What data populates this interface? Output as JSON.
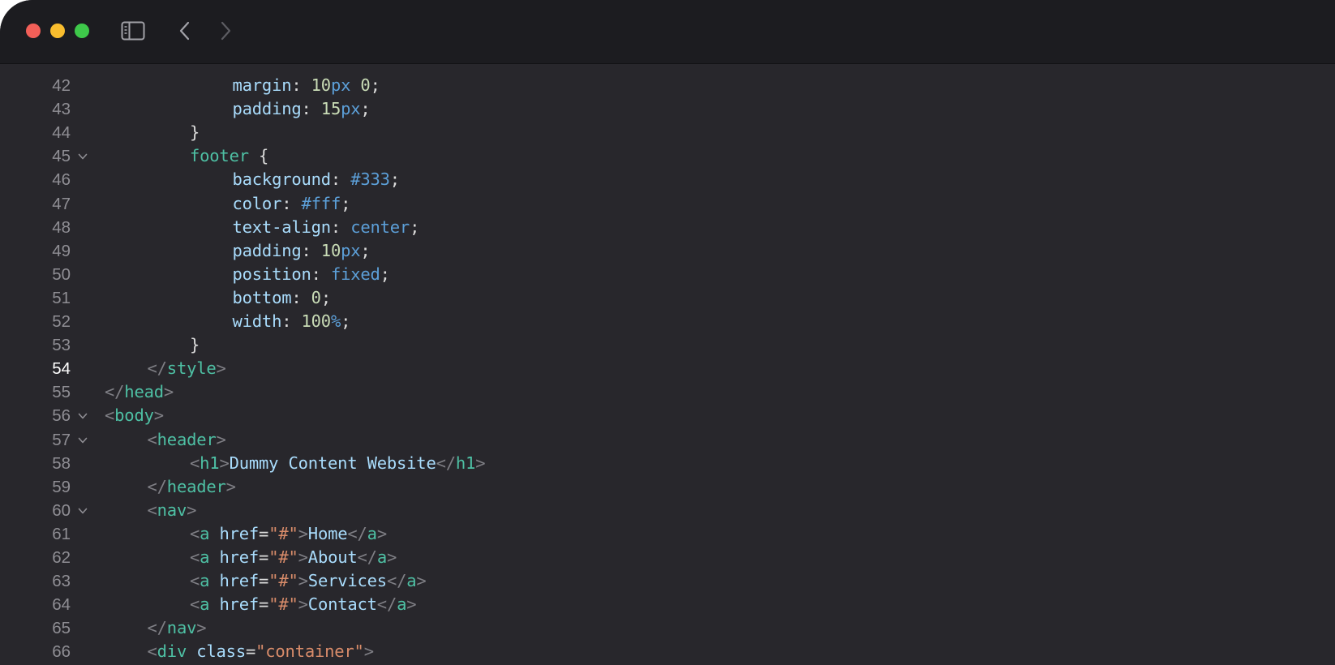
{
  "window": {
    "controls": [
      "close",
      "minimize",
      "zoom"
    ],
    "toolbar_icons": [
      "sidebar-icon",
      "chevron-left-icon",
      "chevron-right-icon"
    ]
  },
  "editor": {
    "current_line": 54,
    "lines": [
      {
        "n": "42",
        "fold": false,
        "indent": 3,
        "tokens": [
          [
            "prop",
            "margin"
          ],
          [
            "pn",
            ": "
          ],
          [
            "num",
            "10"
          ],
          [
            "unit",
            "px"
          ],
          [
            "pn",
            " "
          ],
          [
            "num",
            "0"
          ],
          [
            "pn",
            ";"
          ]
        ]
      },
      {
        "n": "43",
        "fold": false,
        "indent": 3,
        "tokens": [
          [
            "prop",
            "padding"
          ],
          [
            "pn",
            ": "
          ],
          [
            "num",
            "15"
          ],
          [
            "unit",
            "px"
          ],
          [
            "pn",
            ";"
          ]
        ]
      },
      {
        "n": "44",
        "fold": false,
        "indent": 2,
        "tokens": [
          [
            "pn",
            "}"
          ]
        ]
      },
      {
        "n": "45",
        "fold": true,
        "indent": 2,
        "tokens": [
          [
            "sel",
            "footer"
          ],
          [
            "pn",
            " {"
          ]
        ]
      },
      {
        "n": "46",
        "fold": false,
        "indent": 3,
        "tokens": [
          [
            "prop",
            "background"
          ],
          [
            "pn",
            ": "
          ],
          [
            "kw",
            "#333"
          ],
          [
            "pn",
            ";"
          ]
        ]
      },
      {
        "n": "47",
        "fold": false,
        "indent": 3,
        "tokens": [
          [
            "prop",
            "color"
          ],
          [
            "pn",
            ": "
          ],
          [
            "kw",
            "#fff"
          ],
          [
            "pn",
            ";"
          ]
        ]
      },
      {
        "n": "48",
        "fold": false,
        "indent": 3,
        "tokens": [
          [
            "prop",
            "text-align"
          ],
          [
            "pn",
            ": "
          ],
          [
            "kw",
            "center"
          ],
          [
            "pn",
            ";"
          ]
        ]
      },
      {
        "n": "49",
        "fold": false,
        "indent": 3,
        "tokens": [
          [
            "prop",
            "padding"
          ],
          [
            "pn",
            ": "
          ],
          [
            "num",
            "10"
          ],
          [
            "unit",
            "px"
          ],
          [
            "pn",
            ";"
          ]
        ]
      },
      {
        "n": "50",
        "fold": false,
        "indent": 3,
        "tokens": [
          [
            "prop",
            "position"
          ],
          [
            "pn",
            ": "
          ],
          [
            "kw",
            "fixed"
          ],
          [
            "pn",
            ";"
          ]
        ]
      },
      {
        "n": "51",
        "fold": false,
        "indent": 3,
        "tokens": [
          [
            "prop",
            "bottom"
          ],
          [
            "pn",
            ": "
          ],
          [
            "num",
            "0"
          ],
          [
            "pn",
            ";"
          ]
        ]
      },
      {
        "n": "52",
        "fold": false,
        "indent": 3,
        "tokens": [
          [
            "prop",
            "width"
          ],
          [
            "pn",
            ": "
          ],
          [
            "num",
            "100"
          ],
          [
            "unit",
            "%"
          ],
          [
            "pn",
            ";"
          ]
        ]
      },
      {
        "n": "53",
        "fold": false,
        "indent": 2,
        "tokens": [
          [
            "pn",
            "}"
          ]
        ]
      },
      {
        "n": "54",
        "fold": false,
        "indent": 1,
        "tokens": [
          [
            "ang",
            "</"
          ],
          [
            "tag",
            "style"
          ],
          [
            "ang",
            ">"
          ]
        ]
      },
      {
        "n": "55",
        "fold": false,
        "indent": 0,
        "tokens": [
          [
            "ang",
            "</"
          ],
          [
            "tag",
            "head"
          ],
          [
            "ang",
            ">"
          ]
        ]
      },
      {
        "n": "56",
        "fold": true,
        "indent": 0,
        "tokens": [
          [
            "ang",
            "<"
          ],
          [
            "tag",
            "body"
          ],
          [
            "ang",
            ">"
          ]
        ]
      },
      {
        "n": "57",
        "fold": true,
        "indent": 1,
        "tokens": [
          [
            "ang",
            "<"
          ],
          [
            "tag",
            "header"
          ],
          [
            "ang",
            ">"
          ]
        ]
      },
      {
        "n": "58",
        "fold": false,
        "indent": 2,
        "tokens": [
          [
            "ang",
            "<"
          ],
          [
            "tag",
            "h1"
          ],
          [
            "ang",
            ">"
          ],
          [
            "txt",
            "Dummy Content Website"
          ],
          [
            "ang",
            "</"
          ],
          [
            "tag",
            "h1"
          ],
          [
            "ang",
            ">"
          ]
        ]
      },
      {
        "n": "59",
        "fold": false,
        "indent": 1,
        "tokens": [
          [
            "ang",
            "</"
          ],
          [
            "tag",
            "header"
          ],
          [
            "ang",
            ">"
          ]
        ]
      },
      {
        "n": "60",
        "fold": true,
        "indent": 1,
        "tokens": [
          [
            "ang",
            "<"
          ],
          [
            "tag",
            "nav"
          ],
          [
            "ang",
            ">"
          ]
        ]
      },
      {
        "n": "61",
        "fold": false,
        "indent": 2,
        "tokens": [
          [
            "ang",
            "<"
          ],
          [
            "tag",
            "a"
          ],
          [
            "pn",
            " "
          ],
          [
            "attr",
            "href"
          ],
          [
            "pn",
            "="
          ],
          [
            "str",
            "\"#\""
          ],
          [
            "ang",
            ">"
          ],
          [
            "txt",
            "Home"
          ],
          [
            "ang",
            "</"
          ],
          [
            "tag",
            "a"
          ],
          [
            "ang",
            ">"
          ]
        ]
      },
      {
        "n": "62",
        "fold": false,
        "indent": 2,
        "tokens": [
          [
            "ang",
            "<"
          ],
          [
            "tag",
            "a"
          ],
          [
            "pn",
            " "
          ],
          [
            "attr",
            "href"
          ],
          [
            "pn",
            "="
          ],
          [
            "str",
            "\"#\""
          ],
          [
            "ang",
            ">"
          ],
          [
            "txt",
            "About"
          ],
          [
            "ang",
            "</"
          ],
          [
            "tag",
            "a"
          ],
          [
            "ang",
            ">"
          ]
        ]
      },
      {
        "n": "63",
        "fold": false,
        "indent": 2,
        "tokens": [
          [
            "ang",
            "<"
          ],
          [
            "tag",
            "a"
          ],
          [
            "pn",
            " "
          ],
          [
            "attr",
            "href"
          ],
          [
            "pn",
            "="
          ],
          [
            "str",
            "\"#\""
          ],
          [
            "ang",
            ">"
          ],
          [
            "txt",
            "Services"
          ],
          [
            "ang",
            "</"
          ],
          [
            "tag",
            "a"
          ],
          [
            "ang",
            ">"
          ]
        ]
      },
      {
        "n": "64",
        "fold": false,
        "indent": 2,
        "tokens": [
          [
            "ang",
            "<"
          ],
          [
            "tag",
            "a"
          ],
          [
            "pn",
            " "
          ],
          [
            "attr",
            "href"
          ],
          [
            "pn",
            "="
          ],
          [
            "str",
            "\"#\""
          ],
          [
            "ang",
            ">"
          ],
          [
            "txt",
            "Contact"
          ],
          [
            "ang",
            "</"
          ],
          [
            "tag",
            "a"
          ],
          [
            "ang",
            ">"
          ]
        ]
      },
      {
        "n": "65",
        "fold": false,
        "indent": 1,
        "tokens": [
          [
            "ang",
            "</"
          ],
          [
            "tag",
            "nav"
          ],
          [
            "ang",
            ">"
          ]
        ]
      },
      {
        "n": "66",
        "fold": false,
        "indent": 1,
        "tokens": [
          [
            "ang",
            "<"
          ],
          [
            "tag",
            "div"
          ],
          [
            "pn",
            " "
          ],
          [
            "attr",
            "class"
          ],
          [
            "pn",
            "="
          ],
          [
            "str",
            "\"container\""
          ],
          [
            "ang",
            ">"
          ]
        ]
      }
    ]
  }
}
